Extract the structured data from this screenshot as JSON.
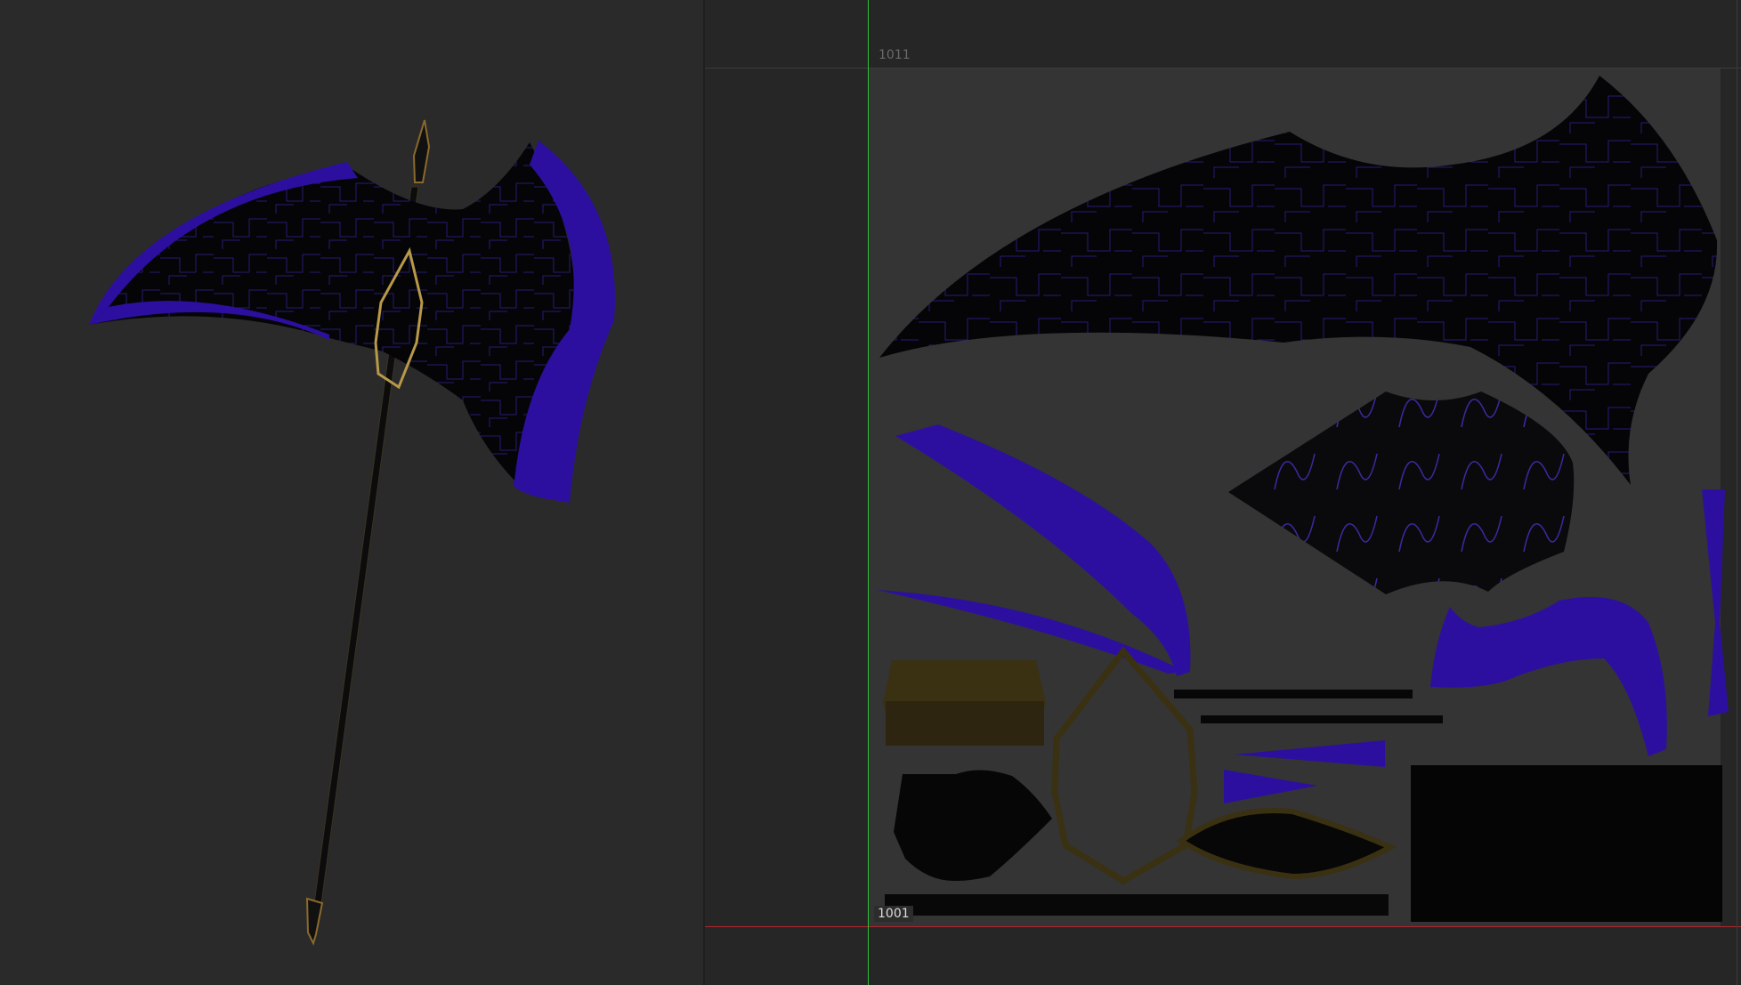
{
  "uv_editor": {
    "tile_upper_label": "1011",
    "tile_lower_label": "1001"
  },
  "colors": {
    "background": "#2a2a2a",
    "uv_background": "#343434",
    "accent_purple": "#2d0fa0",
    "blade_black": "#050508",
    "gold": "#8a6a2a",
    "axis_u": "#b4262b",
    "axis_v": "#2fbf36"
  },
  "icons": {
    "model": "scythe-model",
    "uv_layout": "uv-islands"
  }
}
